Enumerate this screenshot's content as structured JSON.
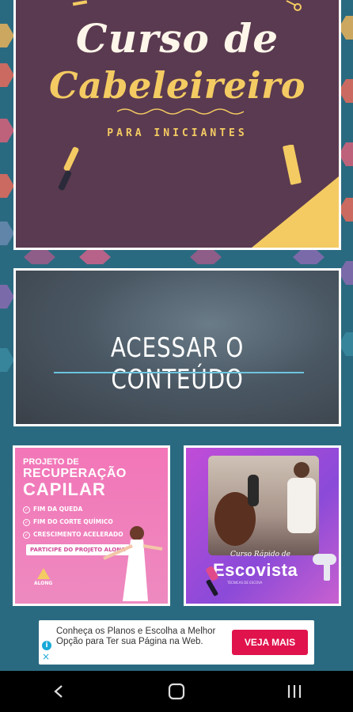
{
  "hero": {
    "title_line1": "Curso de",
    "title_line2": "Cabeleireiro",
    "subtitle": "PARA INICIANTES"
  },
  "access": {
    "label": "ACESSAR O CONTEÚDO"
  },
  "promo_left": {
    "title_line1": "PROJETO DE",
    "title_line2": "RECUPERAÇÃO",
    "title_line3": "CAPILAR",
    "items": [
      "FIM DA QUEDA",
      "FIM DO CORTE QUÍMICO",
      "CRESCIMENTO ACELERADO"
    ],
    "cta": "PARTICIPE DO PROJETO ALONG",
    "logo": "ALONG"
  },
  "promo_right": {
    "subtitle": "Curso Rápido de",
    "title": "Escovista",
    "tagline": "TÉCNICAS DE ESCOVA"
  },
  "ad": {
    "text": "Conheça os Planos e Escolha a Melhor Opção para Ter sua Página na Web.",
    "button": "VEJA MAIS",
    "info_icon": "i",
    "close_icon": "×"
  },
  "colors": {
    "background": "#2a6a80",
    "hero_bg": "#5a3a50",
    "hero_accent": "#f4cb62",
    "ad_button": "#e0134d"
  }
}
